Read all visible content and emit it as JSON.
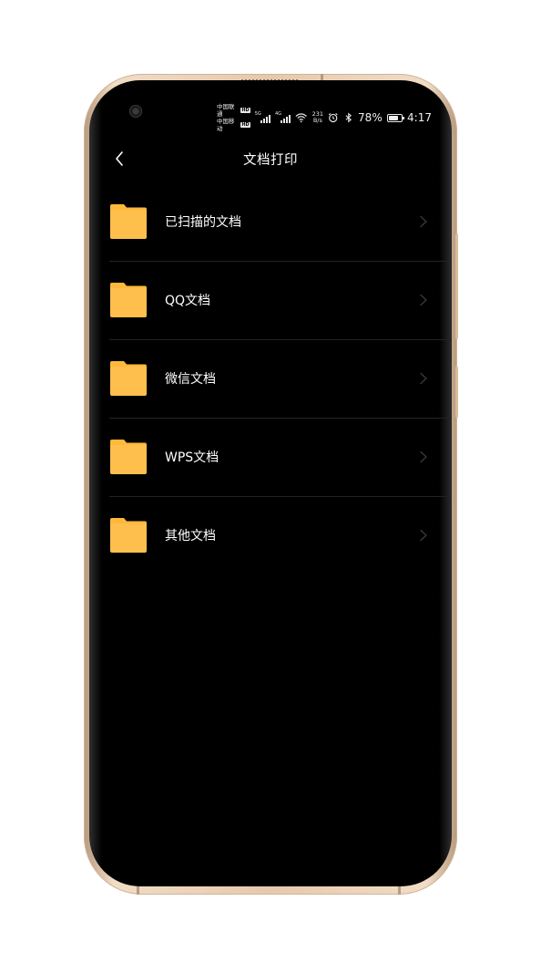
{
  "status_bar": {
    "carrier_1": "中国联通",
    "carrier_2": "中国移动",
    "hd_badge": "HD",
    "signal_1_network": "5G",
    "signal_2_network": "4G",
    "speed_value": "231",
    "speed_unit": "B/s",
    "battery_percent": "78%",
    "battery_level": 0.78,
    "time": "4:17"
  },
  "header": {
    "back_icon": "chevron-left-icon",
    "title": "文档打印"
  },
  "folders": {
    "items": [
      {
        "label": "已扫描的文档",
        "icon": "folder-icon"
      },
      {
        "label": "QQ文档",
        "icon": "folder-icon"
      },
      {
        "label": "微信文档",
        "icon": "folder-icon"
      },
      {
        "label": "WPS文档",
        "icon": "folder-icon"
      },
      {
        "label": "其他文档",
        "icon": "folder-icon"
      }
    ]
  },
  "colors": {
    "folder": "#ffbf4d",
    "folder_tab": "#ffb93a",
    "background": "#000000",
    "text": "#ffffff",
    "divider": "#232323",
    "chevron": "#3a3a3a",
    "phone_frame": "#e6c9ac"
  }
}
